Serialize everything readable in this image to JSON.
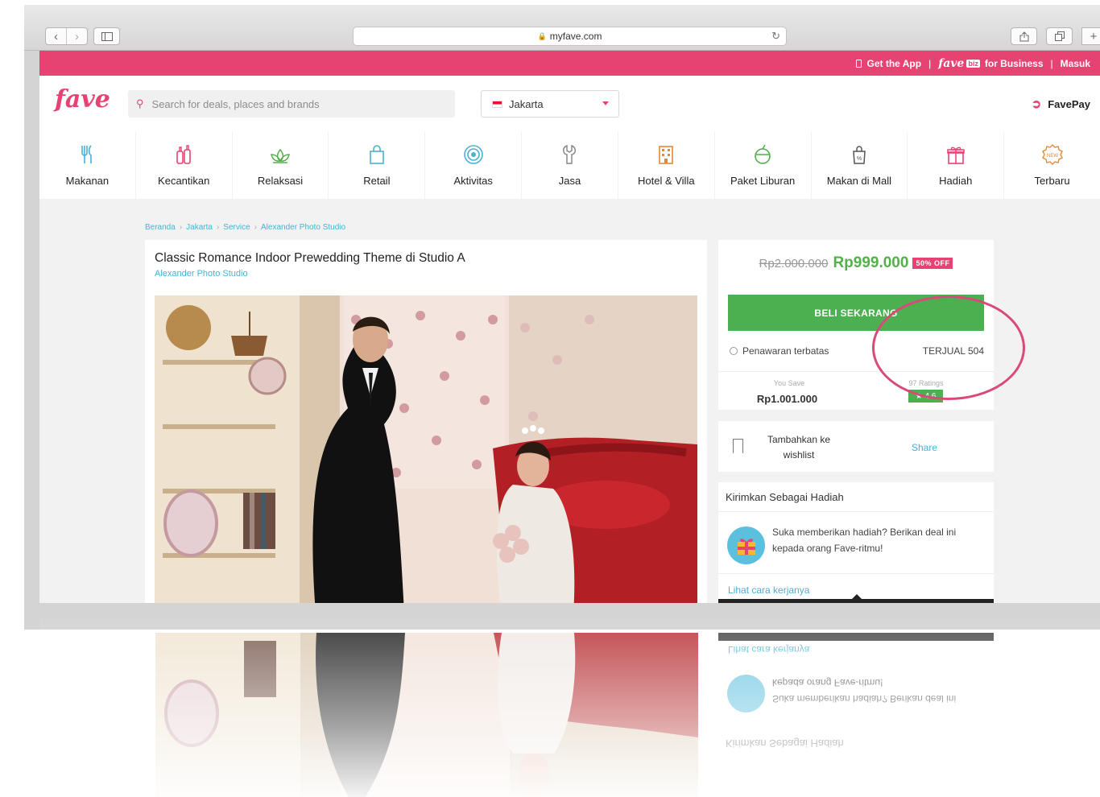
{
  "browser": {
    "url": "myfave.com"
  },
  "topbar": {
    "get_app": "Get the App",
    "fave_logo": "fave",
    "biz_badge": "biz",
    "for_business": "for Business",
    "login": "Masuk",
    "separator": "|"
  },
  "header": {
    "logo": "fave",
    "search_placeholder": "Search for deals, places and brands",
    "city": "Jakarta",
    "favepay": "FavePay"
  },
  "categories": [
    {
      "label": "Makanan",
      "icon": "cutlery-icon"
    },
    {
      "label": "Kecantikan",
      "icon": "beauty-icon"
    },
    {
      "label": "Relaksasi",
      "icon": "lotus-icon"
    },
    {
      "label": "Retail",
      "icon": "shopping-bag-icon"
    },
    {
      "label": "Aktivitas",
      "icon": "target-icon"
    },
    {
      "label": "Jasa",
      "icon": "wrench-icon"
    },
    {
      "label": "Hotel & Villa",
      "icon": "building-icon"
    },
    {
      "label": "Paket Liburan",
      "icon": "coconut-icon"
    },
    {
      "label": "Makan di Mall",
      "icon": "discount-bag-icon"
    },
    {
      "label": "Hadiah",
      "icon": "gift-icon"
    },
    {
      "label": "Terbaru",
      "icon": "new-badge-icon"
    }
  ],
  "breadcrumb": [
    "Beranda",
    "Jakarta",
    "Service",
    "Alexander Photo Studio"
  ],
  "deal": {
    "title": "Classic Romance Indoor Prewedding Theme di Studio A",
    "merchant": "Alexander Photo Studio"
  },
  "pricing": {
    "old_price": "Rp2.000.000",
    "new_price": "Rp999.000",
    "discount": "50% OFF",
    "buy_label": "BELI SEKARANG",
    "limited_label": "Penawaran terbatas",
    "sold_label": "TERJUAL 504",
    "save_label": "You Save",
    "save_value": "Rp1.001.000",
    "ratings_label": "97 Ratings",
    "rating_value": "★ 4.6"
  },
  "wishlist": {
    "label": "Tambahkan ke wishlist",
    "share": "Share"
  },
  "gift": {
    "heading": "Kirimkan Sebagai Hadiah",
    "body": "Suka memberikan hadiah? Berikan deal ini kepada orang Fave-ritmu!",
    "link": "Lihat cara kerjanya"
  },
  "colors": {
    "brand": "#e64372",
    "price": "#53b04b",
    "button": "#4caf50",
    "link": "#4ab1d3",
    "annotation": "#d94a7a"
  }
}
